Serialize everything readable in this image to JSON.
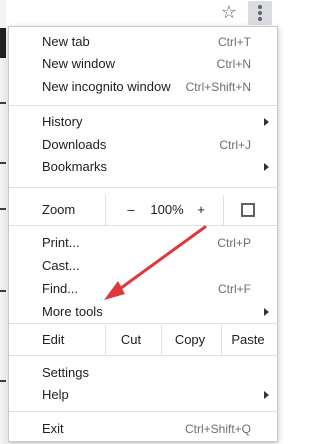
{
  "menu": {
    "group1": [
      {
        "label": "New tab",
        "shortcut": "Ctrl+T"
      },
      {
        "label": "New window",
        "shortcut": "Ctrl+N"
      },
      {
        "label": "New incognito window",
        "shortcut": "Ctrl+Shift+N"
      }
    ],
    "group2": [
      {
        "label": "History",
        "shortcut": ""
      },
      {
        "label": "Downloads",
        "shortcut": "Ctrl+J"
      },
      {
        "label": "Bookmarks",
        "shortcut": ""
      }
    ],
    "zoom": {
      "label": "Zoom",
      "minus": "–",
      "level": "100%",
      "plus": "+"
    },
    "group3": [
      {
        "label": "Print...",
        "shortcut": "Ctrl+P"
      },
      {
        "label": "Cast...",
        "shortcut": ""
      },
      {
        "label": "Find...",
        "shortcut": "Ctrl+F"
      },
      {
        "label": "More tools",
        "shortcut": ""
      }
    ],
    "edit": {
      "label": "Edit",
      "cut": "Cut",
      "copy": "Copy",
      "paste": "Paste"
    },
    "group4": [
      {
        "label": "Settings",
        "shortcut": ""
      },
      {
        "label": "Help",
        "shortcut": ""
      }
    ],
    "exit": {
      "label": "Exit",
      "shortcut": "Ctrl+Shift+Q"
    }
  },
  "colors": {
    "annotation_arrow": "#e0383a"
  }
}
